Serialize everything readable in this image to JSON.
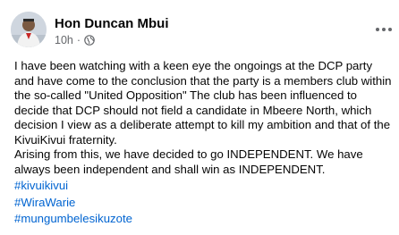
{
  "post": {
    "author": "Hon Duncan Mbui",
    "time": "10h",
    "separator": "·",
    "privacy_icon": "globe-icon",
    "more_icon": "more-dots-icon",
    "paragraphs": [
      "I have been watching with a keen eye the ongoings at the DCP party and have come to the conclusion that the party is a members club within the so-called \"United Opposition\" The club has been influenced to decide that DCP should not field a candidate in Mbeere North, which decision I view as a deliberate attempt to kill my ambition and that of the KivuiKivui fraternity.",
      "Arising from this, we have decided to go INDEPENDENT. We have always been independent and shall win as INDEPENDENT."
    ],
    "hashtags": [
      "#kivuikivui",
      "#WiraWarie",
      "#mungumbelesikuzote"
    ]
  },
  "colors": {
    "text": "#050505",
    "meta": "#65676b",
    "link": "#0064d1"
  }
}
